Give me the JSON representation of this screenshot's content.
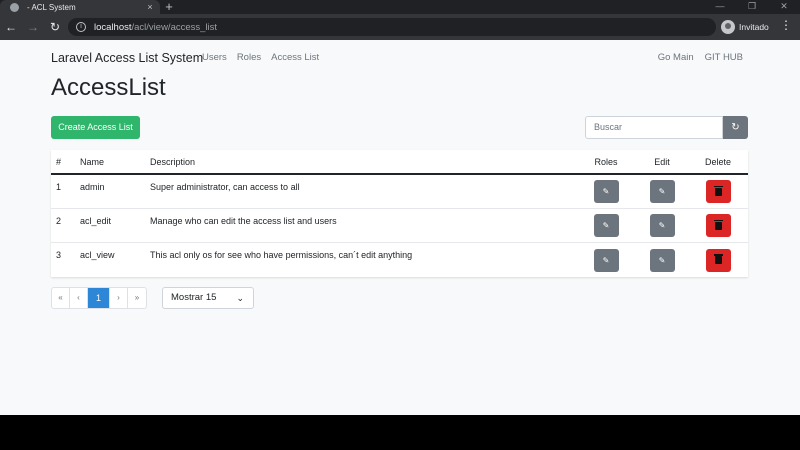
{
  "browser": {
    "tab_title": "- ACL System",
    "tab_close": "×",
    "new_tab": "+",
    "url_host": "localhost",
    "url_path": "/acl/view/access_list",
    "profile_name": "Invitado",
    "back_icon": "←",
    "forward_icon": "→",
    "reload_icon": "↻",
    "win_min": "—",
    "win_max": "❐",
    "win_close": "✕"
  },
  "navbar": {
    "brand": "Laravel Access List System",
    "links": [
      "Users",
      "Roles",
      "Access List"
    ],
    "right_links": [
      "Go Main",
      "GIT HUB"
    ]
  },
  "page": {
    "title": "AccessList",
    "create_label": "Create Access List",
    "search_placeholder": "Buscar",
    "refresh_icon": "↻"
  },
  "table": {
    "headers": [
      "#",
      "Name",
      "Description",
      "Roles",
      "Edit",
      "Delete"
    ],
    "rows": [
      {
        "id": "1",
        "name": "admin",
        "description": "Super administrator, can access to all"
      },
      {
        "id": "2",
        "name": "acl_edit",
        "description": "Manage who can edit the access list and users"
      },
      {
        "id": "3",
        "name": "acl_view",
        "description": "This acl only os for see who have permissions, can´t edit anything"
      }
    ],
    "edit_icon": "✎"
  },
  "pagination": {
    "first": "«",
    "prev": "‹",
    "current": "1",
    "next": "›",
    "last": "»",
    "show_label": "Mostrar 15",
    "chevron": "⌄"
  },
  "colors": {
    "create": "#2fb66c",
    "delete": "#dc2626",
    "action": "#6c757d",
    "page_active": "#2d86d6"
  }
}
